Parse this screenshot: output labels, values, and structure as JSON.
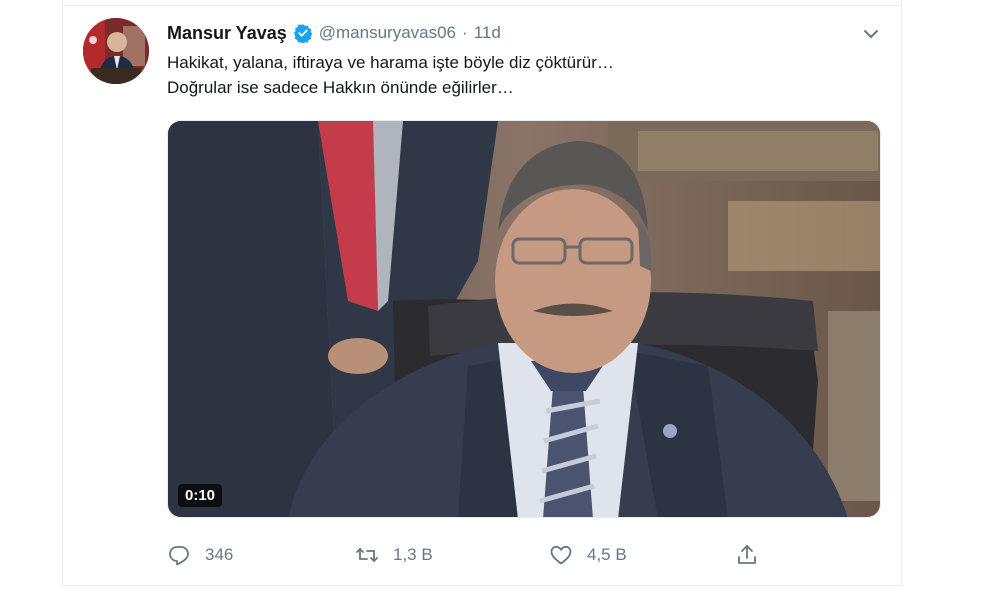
{
  "tweet": {
    "author_name": "Mansur Yavaş",
    "handle": "@mansuryavas06",
    "separator": "·",
    "time": "11d",
    "text_line1": "Hakikat, yalana, iftiraya ve harama işte böyle diz çöktürür…",
    "text_line2": "Doğrular ise sadece Hakkın önünde eğilirler…",
    "video_duration": "0:10"
  },
  "actions": {
    "replies": "346",
    "retweets": "1,3 B",
    "likes": "4,5 B"
  },
  "icons": {
    "reply": "reply-icon",
    "retweet": "retweet-icon",
    "like": "heart-icon",
    "share": "share-icon",
    "verified": "verified-badge-icon",
    "more": "chevron-down-icon"
  },
  "colors": {
    "verified": "#1da1f2",
    "text": "#14171a",
    "muted": "#657786"
  }
}
